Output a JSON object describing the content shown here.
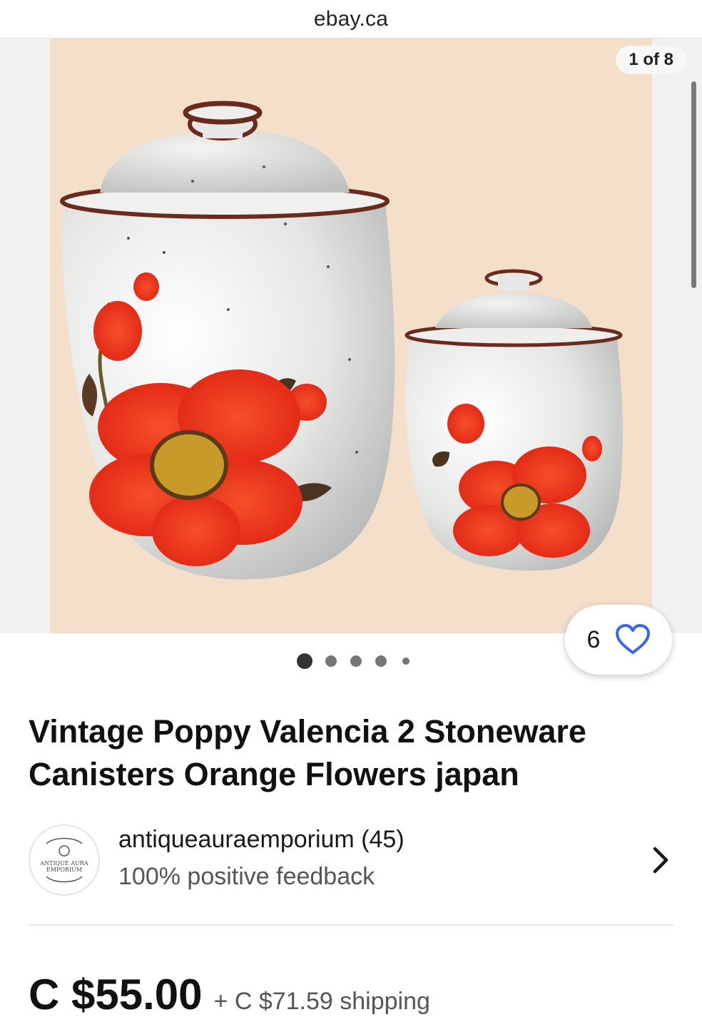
{
  "browser": {
    "url": "ebay.ca"
  },
  "gallery": {
    "counter": "1 of 8",
    "watch_count": "6",
    "image_alt": "Two speckled stoneware canisters with lids decorated with red poppy flowers",
    "dots": 5,
    "active_dot": 1
  },
  "listing": {
    "title": "Vintage Poppy Valencia 2 Stoneware Canisters Orange Flowers japan"
  },
  "seller": {
    "name": "antiqueauraemporium (45)",
    "feedback": "100% positive feedback",
    "logo_text_line1": "ANTIQUE AURA",
    "logo_text_line2": "EMPORIUM"
  },
  "pricing": {
    "price": "C $55.00",
    "shipping": "+ C $71.59 shipping"
  },
  "colors": {
    "photo_background": "#f3dfca",
    "poppy_red": "#e8341c",
    "text_primary": "#111111",
    "text_secondary": "#555555",
    "heart_blue": "#3665f3"
  }
}
